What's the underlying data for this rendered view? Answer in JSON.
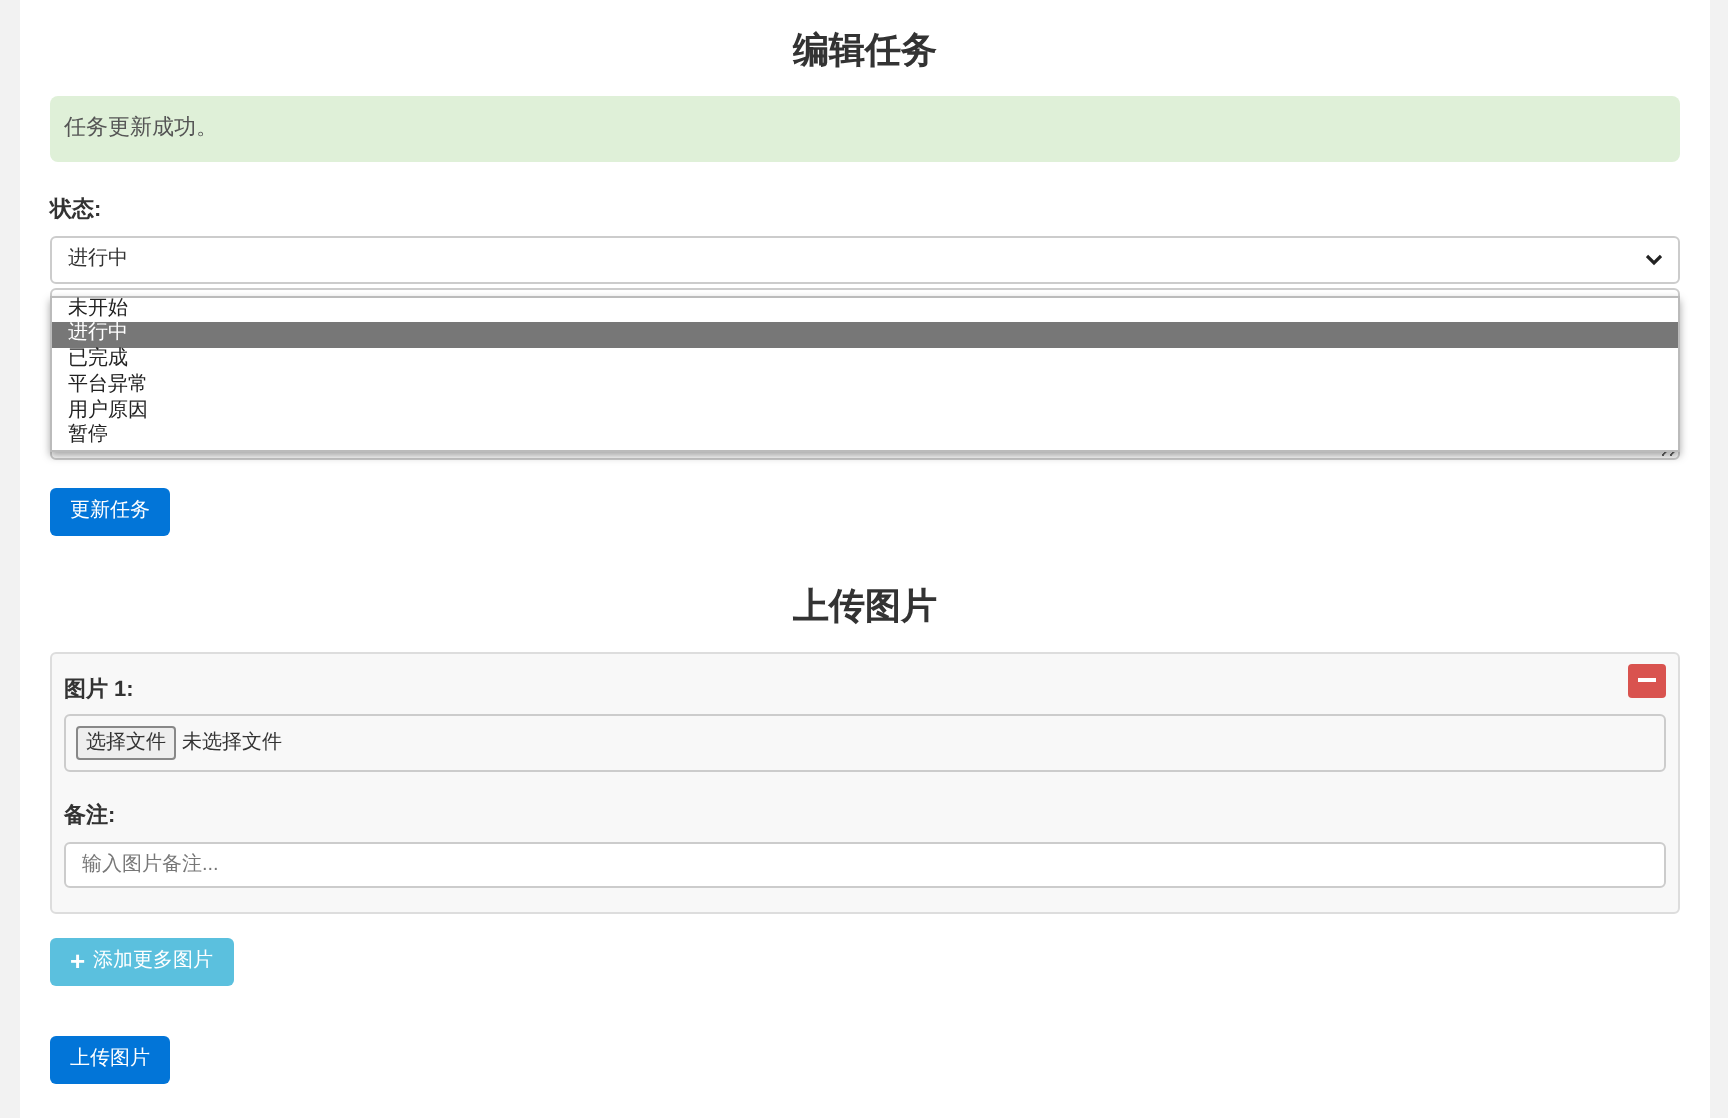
{
  "title": "编辑任务",
  "alert": "任务更新成功。",
  "status": {
    "label": "状态:",
    "value": "进行中",
    "expanded": true,
    "options": [
      {
        "label": "未开始",
        "selected": false
      },
      {
        "label": "进行中",
        "selected": true
      },
      {
        "label": "已完成",
        "selected": false
      },
      {
        "label": "平台异常",
        "selected": false
      },
      {
        "label": "用户原因",
        "selected": false
      },
      {
        "label": "暂停",
        "selected": false
      }
    ]
  },
  "update_button": "更新任务",
  "upload": {
    "title": "上传图片",
    "images": [
      {
        "label": "图片 1:",
        "file_button": "选择文件",
        "file_status": "未选择文件",
        "note_label": "备注:",
        "note_placeholder": "输入图片备注..."
      }
    ],
    "add_button": "添加更多图片",
    "add_icon": "+",
    "upload_button": "上传图片"
  }
}
